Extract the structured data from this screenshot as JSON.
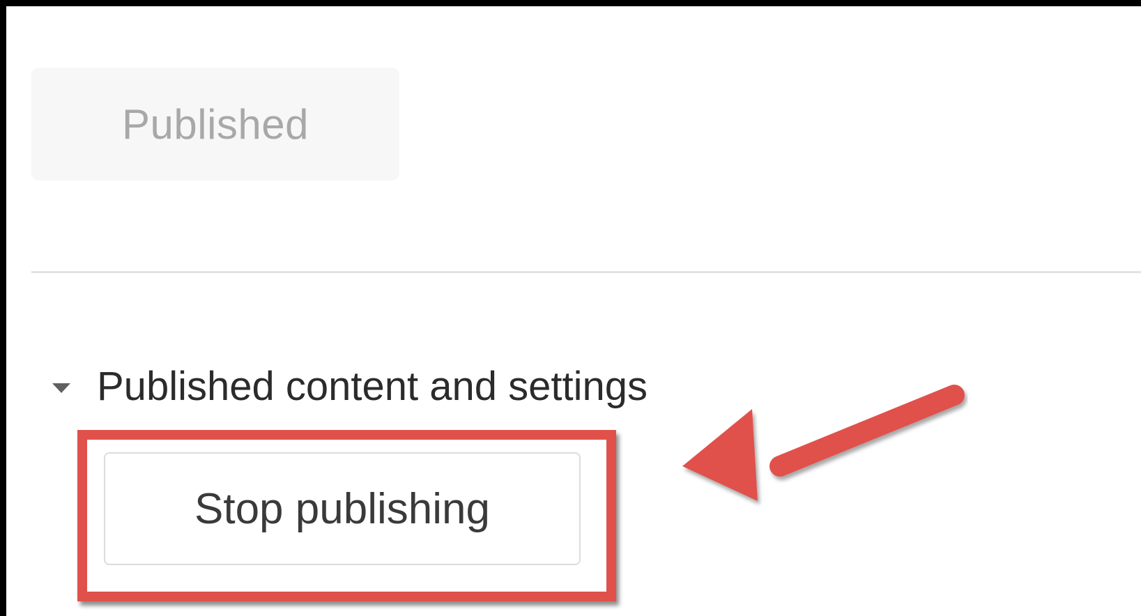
{
  "status": {
    "published_label": "Published"
  },
  "publish_section": {
    "title": "Published content and settings",
    "expanded": true,
    "stop_button_label": "Stop publishing"
  },
  "annotation": {
    "highlight_color": "#e0514c",
    "arrow_color": "#e0514c"
  }
}
